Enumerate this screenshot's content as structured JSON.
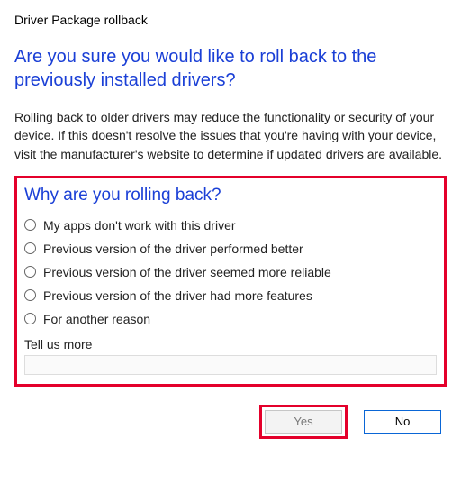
{
  "window_title": "Driver Package rollback",
  "headline": "Are you sure you would like to roll back to the previously installed drivers?",
  "body": "Rolling back to older drivers may reduce the functionality or security of your device. If this doesn't resolve the issues that you're having with your device, visit the manufacturer's website to determine if updated drivers are available.",
  "subhead": "Why are you rolling back?",
  "reasons": [
    "My apps don't work with this driver",
    "Previous version of the driver performed better",
    "Previous version of the driver seemed more reliable",
    "Previous version of the driver had more features",
    "For another reason"
  ],
  "tellmore_label": "Tell us more",
  "tellmore_value": "",
  "buttons": {
    "yes": "Yes",
    "no": "No"
  },
  "highlight_color": "#e4002b",
  "accent_color": "#1a3fd6"
}
